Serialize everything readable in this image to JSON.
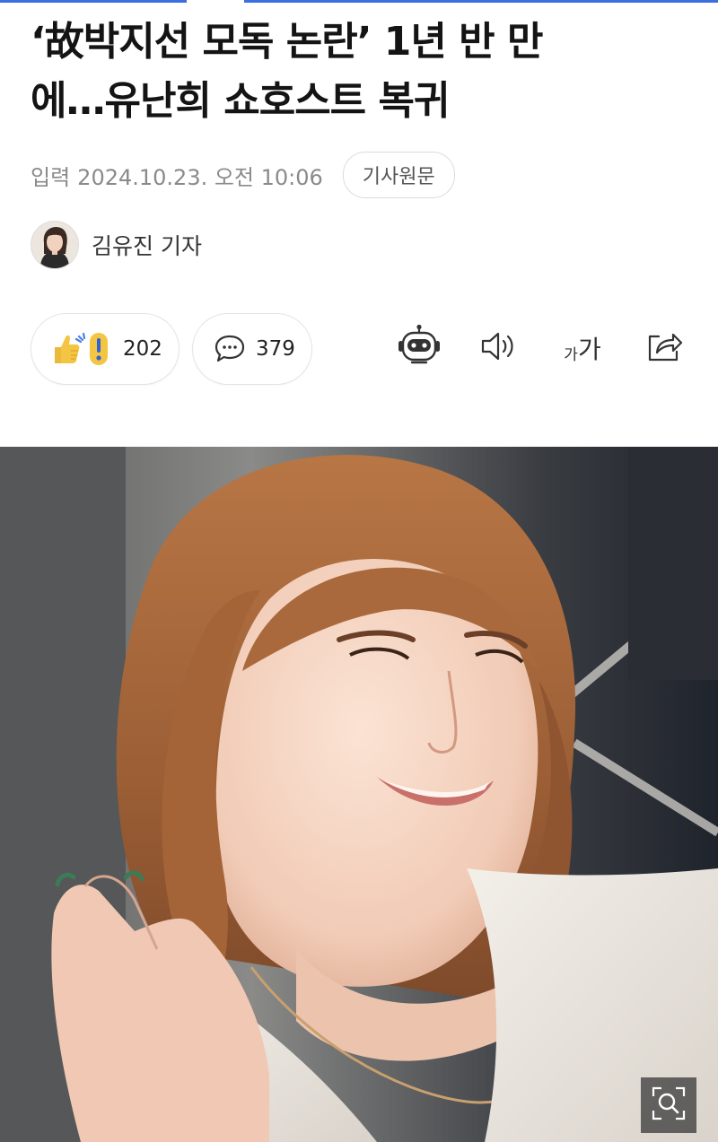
{
  "article": {
    "headline_line1": "‘故박지선 모독 논란’ 1년 반 만",
    "headline_line2": "에…유난희 쇼호스트 복귀",
    "meta_label": "입력",
    "date": "2024.10.23. 오전 10:06",
    "source_button": "기사원문"
  },
  "reporter": {
    "name": "김유진 기자"
  },
  "actions": {
    "reaction_count": "202",
    "comment_count": "379",
    "font_small_glyph": "가",
    "font_big_glyph": "가"
  },
  "icons": {
    "reaction": "thumbs-up-exclamation-icon",
    "comment": "speech-bubble-icon",
    "summary_bot": "robot-icon",
    "tts": "speaker-icon",
    "font_size": "font-size-icon",
    "share": "share-icon",
    "zoom": "magnify-icon"
  },
  "colors": {
    "accent": "#3b6fe0",
    "meta_text": "#8a8a8a",
    "headline_text": "#141414"
  }
}
